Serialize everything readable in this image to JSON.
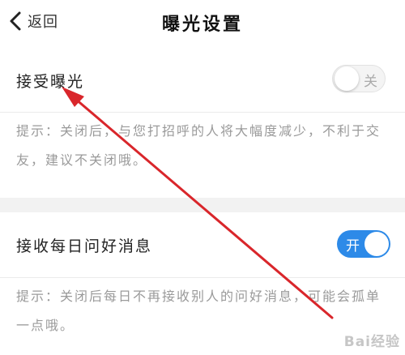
{
  "header": {
    "back_label": "返回",
    "title": "曝光设置"
  },
  "exposure": {
    "label": "接受曝光",
    "toggle_text": "关",
    "enabled": false,
    "hint": "提示：关闭后，与您打招呼的人将大幅度减少，不利于交友，建议不关闭哦。"
  },
  "daily_greeting": {
    "label": "接收每日问好消息",
    "toggle_text": "开",
    "enabled": true,
    "hint": "提示：关闭后每日不再接收别人的问好消息，可能会孤单一点哦。"
  },
  "watermark": "Bai经验",
  "colors": {
    "toggle_on": "#2d8ae8",
    "annotation_arrow": "#d9262b",
    "section_gap": "#f2f2f2"
  }
}
